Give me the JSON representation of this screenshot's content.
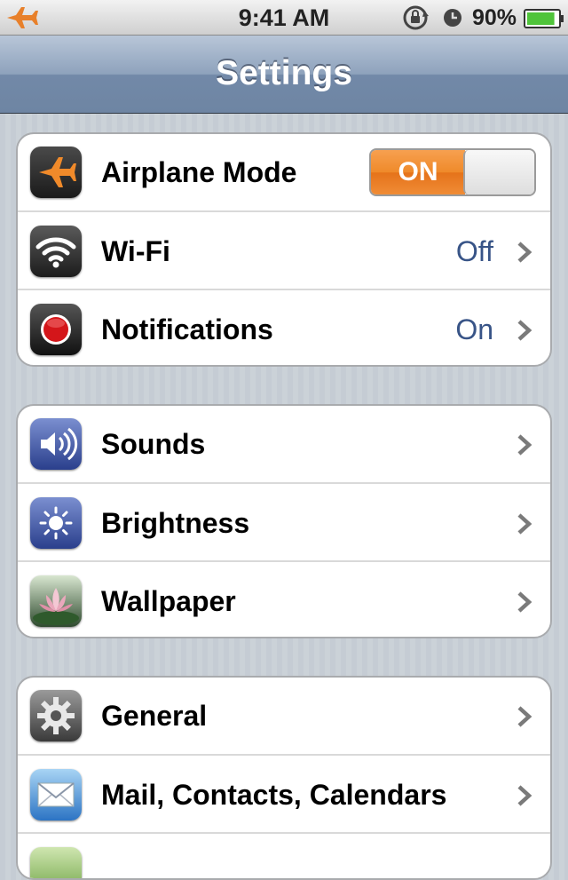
{
  "status_bar": {
    "time": "9:41 AM",
    "battery_percent": "90%",
    "battery_level": 0.9
  },
  "nav": {
    "title": "Settings"
  },
  "groups": [
    {
      "rows": [
        {
          "label": "Airplane Mode",
          "icon": "airplane-icon",
          "toggle": "ON"
        },
        {
          "label": "Wi-Fi",
          "icon": "wifi-icon",
          "value": "Off"
        },
        {
          "label": "Notifications",
          "icon": "notifications-icon",
          "value": "On"
        }
      ]
    },
    {
      "rows": [
        {
          "label": "Sounds",
          "icon": "speaker-icon"
        },
        {
          "label": "Brightness",
          "icon": "sun-icon"
        },
        {
          "label": "Wallpaper",
          "icon": "lotus-icon"
        }
      ]
    },
    {
      "rows": [
        {
          "label": "General",
          "icon": "gear-icon"
        },
        {
          "label": "Mail, Contacts, Calendars",
          "icon": "mail-icon"
        }
      ]
    }
  ],
  "colors": {
    "accent_orange": "#ef8a2a",
    "value_blue": "#385487",
    "nav_blue": "#7289a8"
  }
}
